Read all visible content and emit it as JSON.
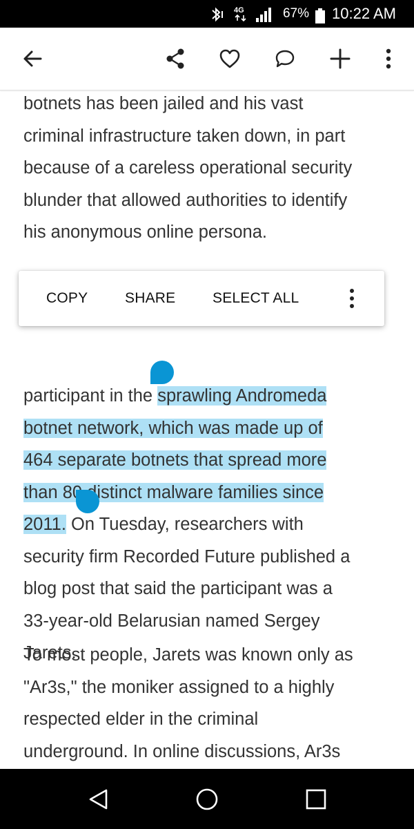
{
  "status_bar": {
    "network_label": "4G",
    "battery": "67%",
    "time": "10:22 AM",
    "icons": [
      "bluetooth-icon",
      "network-4g-icon",
      "signal-icon",
      "battery-icon"
    ]
  },
  "app_bar": {
    "icons": [
      "back-arrow-icon",
      "share-icon",
      "heart-icon",
      "comment-icon",
      "plus-icon",
      "more-vert-icon"
    ]
  },
  "article": {
    "paragraph_1": [
      "botnets has been jailed and his vast",
      "criminal infrastructure taken down, in part",
      "because of a careless operational security",
      "blunder that allowed authorities to identify",
      "his anonymous online persona."
    ],
    "paragraph_2": {
      "line_1_plain": "participant in the ",
      "line_1_selected": "sprawling Andromeda",
      "line_2_selected": "botnet network, which was made up of",
      "line_3_selected": "464 separate botnets that spread more",
      "line_4_selected": "than 80 distinct malware families since",
      "line_5_selected": "2011.",
      "line_5_plain": " On Tuesday, researchers with",
      "line_6": "security firm Recorded Future published a",
      "line_7": "blog post that said the participant was a",
      "line_8": "33-year-old Belarusian named Sergey",
      "line_9": "Jarets."
    },
    "paragraph_3": [
      "To most people, Jarets was known only as",
      "\"Ar3s,\" the moniker assigned to a highly",
      "respected elder in the criminal",
      "underground. In online discussions, Ar3s"
    ]
  },
  "context_menu": {
    "copy": "COPY",
    "share": "SHARE",
    "select_all": "SELECT ALL"
  },
  "nav_bar": {
    "icons": [
      "nav-back-icon",
      "nav-home-icon",
      "nav-recents-icon"
    ]
  },
  "colors": {
    "selection_highlight": "#aee0f5",
    "selection_handle": "#0a95d4",
    "body_text": "#333333"
  }
}
